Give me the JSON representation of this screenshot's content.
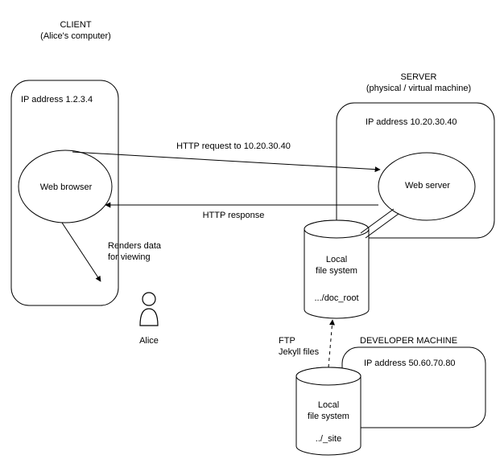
{
  "client": {
    "header1": "CLIENT",
    "header2": "(Alice's computer)",
    "ip_label": "IP address 1.2.3.4",
    "browser_label": "Web browser"
  },
  "server": {
    "header1": "SERVER",
    "header2": "(physical / virtual machine)",
    "ip_label": "IP address 10.20.30.40",
    "webserver_label": "Web server",
    "fs_label1": "Local",
    "fs_label2": "file system",
    "fs_path": ".../doc_root"
  },
  "dev": {
    "header": "DEVELOPER MACHINE",
    "ip_label": "IP address 50.60.70.80",
    "fs_label1": "Local",
    "fs_label2": "file system",
    "fs_path": "../_site"
  },
  "arrows": {
    "http_request": "HTTP request to 10.20.30.40",
    "http_response": "HTTP response",
    "renders": "Renders data\nfor viewing",
    "ftp1": "FTP",
    "ftp2": "Jekyll files"
  },
  "alice": {
    "name": "Alice"
  }
}
